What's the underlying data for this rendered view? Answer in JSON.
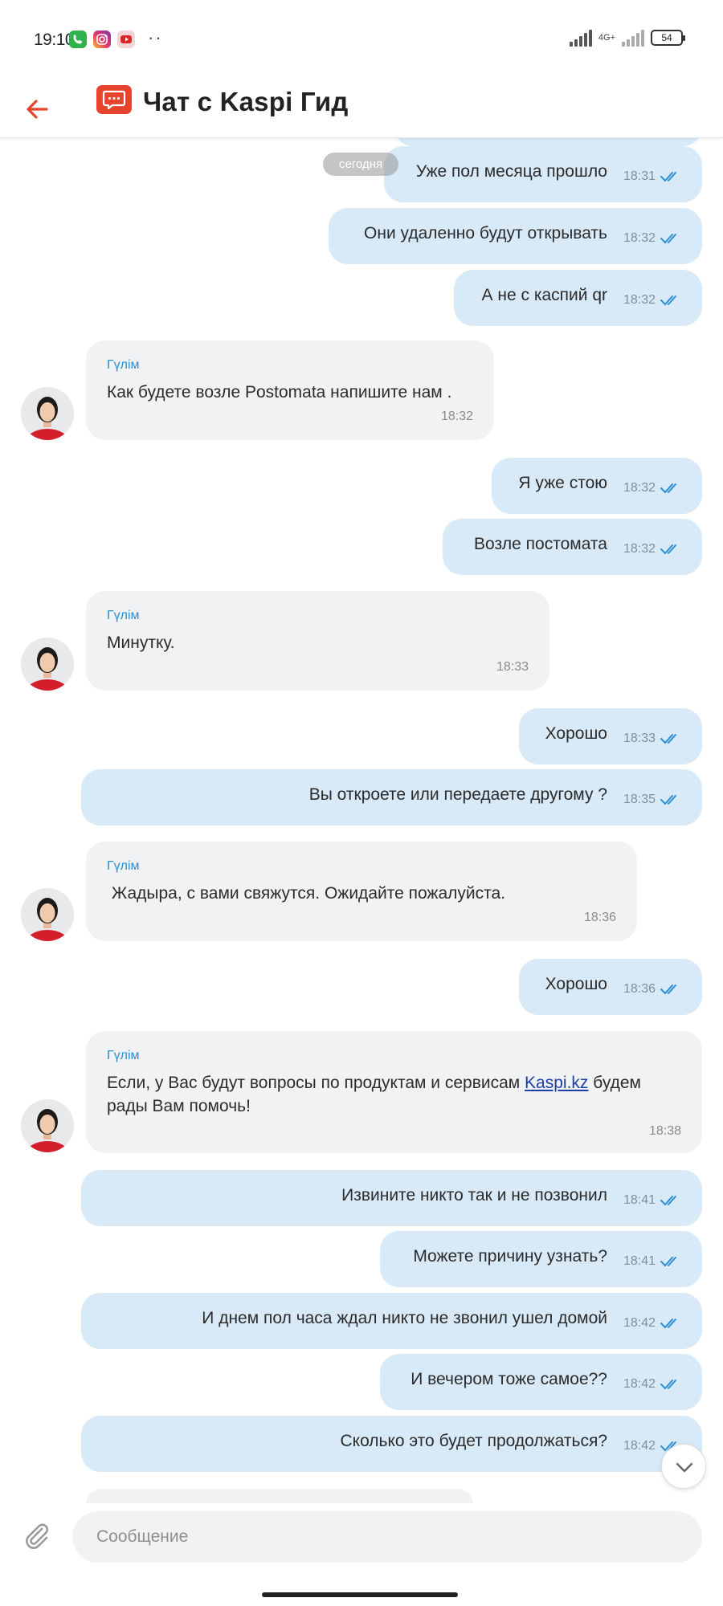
{
  "status_bar": {
    "time": "19:10",
    "dots": "··",
    "network": "4G+",
    "battery": "54",
    "apps": [
      "phone-icon",
      "instagram-icon",
      "youtube-icon"
    ]
  },
  "header": {
    "title": "Чат с Kaspi Гид",
    "accent_color": "#e8432e"
  },
  "date_label": "сегодня",
  "messages": [
    {
      "dir": "out",
      "text": "Уже пол месяца прошло",
      "time": "18:31"
    },
    {
      "dir": "out",
      "text": "Они удаленно будут открывать",
      "time": "18:32"
    },
    {
      "dir": "out",
      "text": "А не с каспий qr",
      "time": "18:32"
    },
    {
      "dir": "in",
      "sender": "Гүлім",
      "text": "Как  будете возле Postomata напишите нам .",
      "time": "18:32"
    },
    {
      "dir": "out",
      "text": "Я уже стою",
      "time": "18:32"
    },
    {
      "dir": "out",
      "text": "Возле постомата",
      "time": "18:32"
    },
    {
      "dir": "in",
      "sender": "Гүлім",
      "text": "Минутку.",
      "time": "18:33"
    },
    {
      "dir": "out",
      "text": "Хорошо",
      "time": "18:33"
    },
    {
      "dir": "out",
      "text": "Вы откроете или передаете другому ?",
      "time": "18:35"
    },
    {
      "dir": "in",
      "sender": "Гүлім",
      "text": " Жадыра, с вами свяжутся. Ожидайте пожалуйста.",
      "time": "18:36"
    },
    {
      "dir": "out",
      "text": "Хорошо",
      "time": "18:36"
    },
    {
      "dir": "in",
      "sender": "Гүлім",
      "text_before": "Если, у Вас будут вопросы по продуктам и сервисам ",
      "link": "Kaspi.kz",
      "text_after": " будем рады Вам помочь!",
      "time": "18:38"
    },
    {
      "dir": "out",
      "text": "Извините никто так и не позвонил",
      "time": "18:41"
    },
    {
      "dir": "out",
      "text": "Можете причину узнать?",
      "time": "18:41"
    },
    {
      "dir": "out",
      "text": "И днем пол часа ждал никто не звонил ушел домой",
      "time": "18:42"
    },
    {
      "dir": "out",
      "text": "И вечером тоже самое??",
      "time": "18:42"
    },
    {
      "dir": "out",
      "text": "Сколько это будет продолжаться?",
      "time": "18:42"
    }
  ],
  "composer": {
    "placeholder": "Сообщение"
  }
}
